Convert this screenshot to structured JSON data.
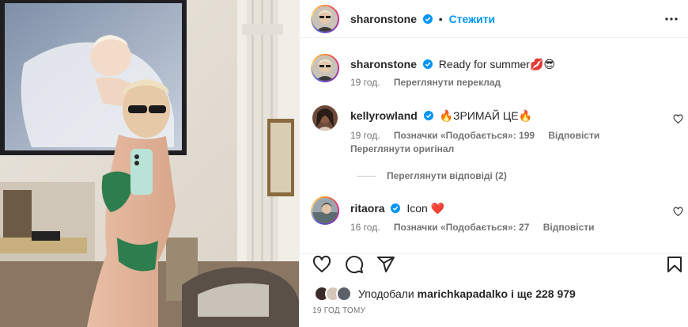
{
  "post": {
    "author": "sharonstone",
    "follow_label": "Стежити",
    "separator": "•"
  },
  "caption": {
    "author": "sharonstone",
    "text": "Ready for summer💋😎",
    "time": "19 год.",
    "translate_label": "Переглянути переклад"
  },
  "comments": [
    {
      "author": "kellyrowland",
      "text": "🔥ЗРИМАЙ ЦЕ🔥",
      "time": "19 год.",
      "likes": "Позначки «Подобається»: 199",
      "reply": "Відповісти",
      "original": "Переглянути оригінал"
    },
    {
      "author": "ritaora",
      "text": "Icon ❤️",
      "time": "16 год.",
      "likes": "Позначки «Подобається»: 27",
      "reply": "Відповісти"
    }
  ],
  "view_replies": "Переглянути відповіді (2)",
  "likes_summary": {
    "prefix": "Уподобали",
    "user": "marichkapadalko",
    "suffix": "і ще 228 979"
  },
  "time_ago": "19 ГОД ТОМУ",
  "icons": [
    "verified-icon",
    "more-icon",
    "heart-icon",
    "comment-icon",
    "share-icon",
    "bookmark-icon"
  ],
  "colors": {
    "link": "#0095f6",
    "verified": "#0095f6",
    "muted": "#737373",
    "text": "#262626"
  }
}
